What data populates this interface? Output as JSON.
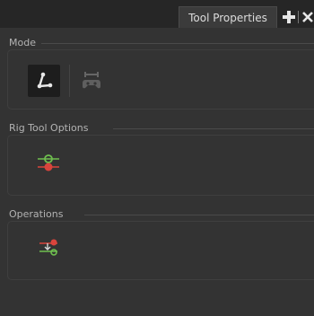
{
  "tab": {
    "title": "Tool Properties"
  },
  "mode": {
    "title": "Mode",
    "buttons": [
      {
        "icon": "rig-bone-icon",
        "active": true
      },
      {
        "icon": "game-rig-icon",
        "active": false
      }
    ]
  },
  "rig_tool_options": {
    "title": "Rig Tool Options"
  },
  "operations": {
    "title": "Operations"
  },
  "colors": {
    "green": "#6fbf4f",
    "red": "#d9443c",
    "background": "#333333"
  }
}
